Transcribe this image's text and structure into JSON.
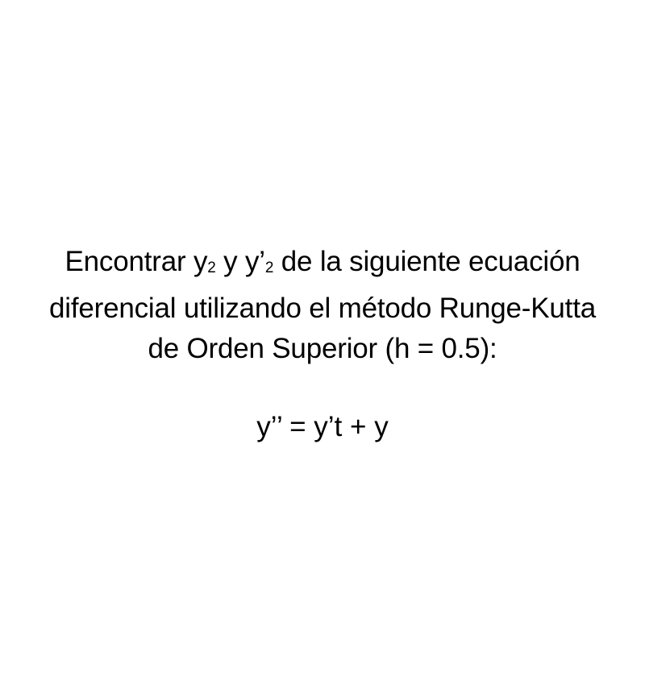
{
  "problem": {
    "line1": {
      "before": "Encontrar y",
      "sub1": "2",
      "mid": " y y’",
      "sub2": "2",
      "after": " de la siguiente ecuación"
    },
    "line2": "diferencial utilizando el método Runge-Kutta",
    "line3": "de Orden Superior (h = 0.5):"
  },
  "equation": "y’’ = y’t + y"
}
